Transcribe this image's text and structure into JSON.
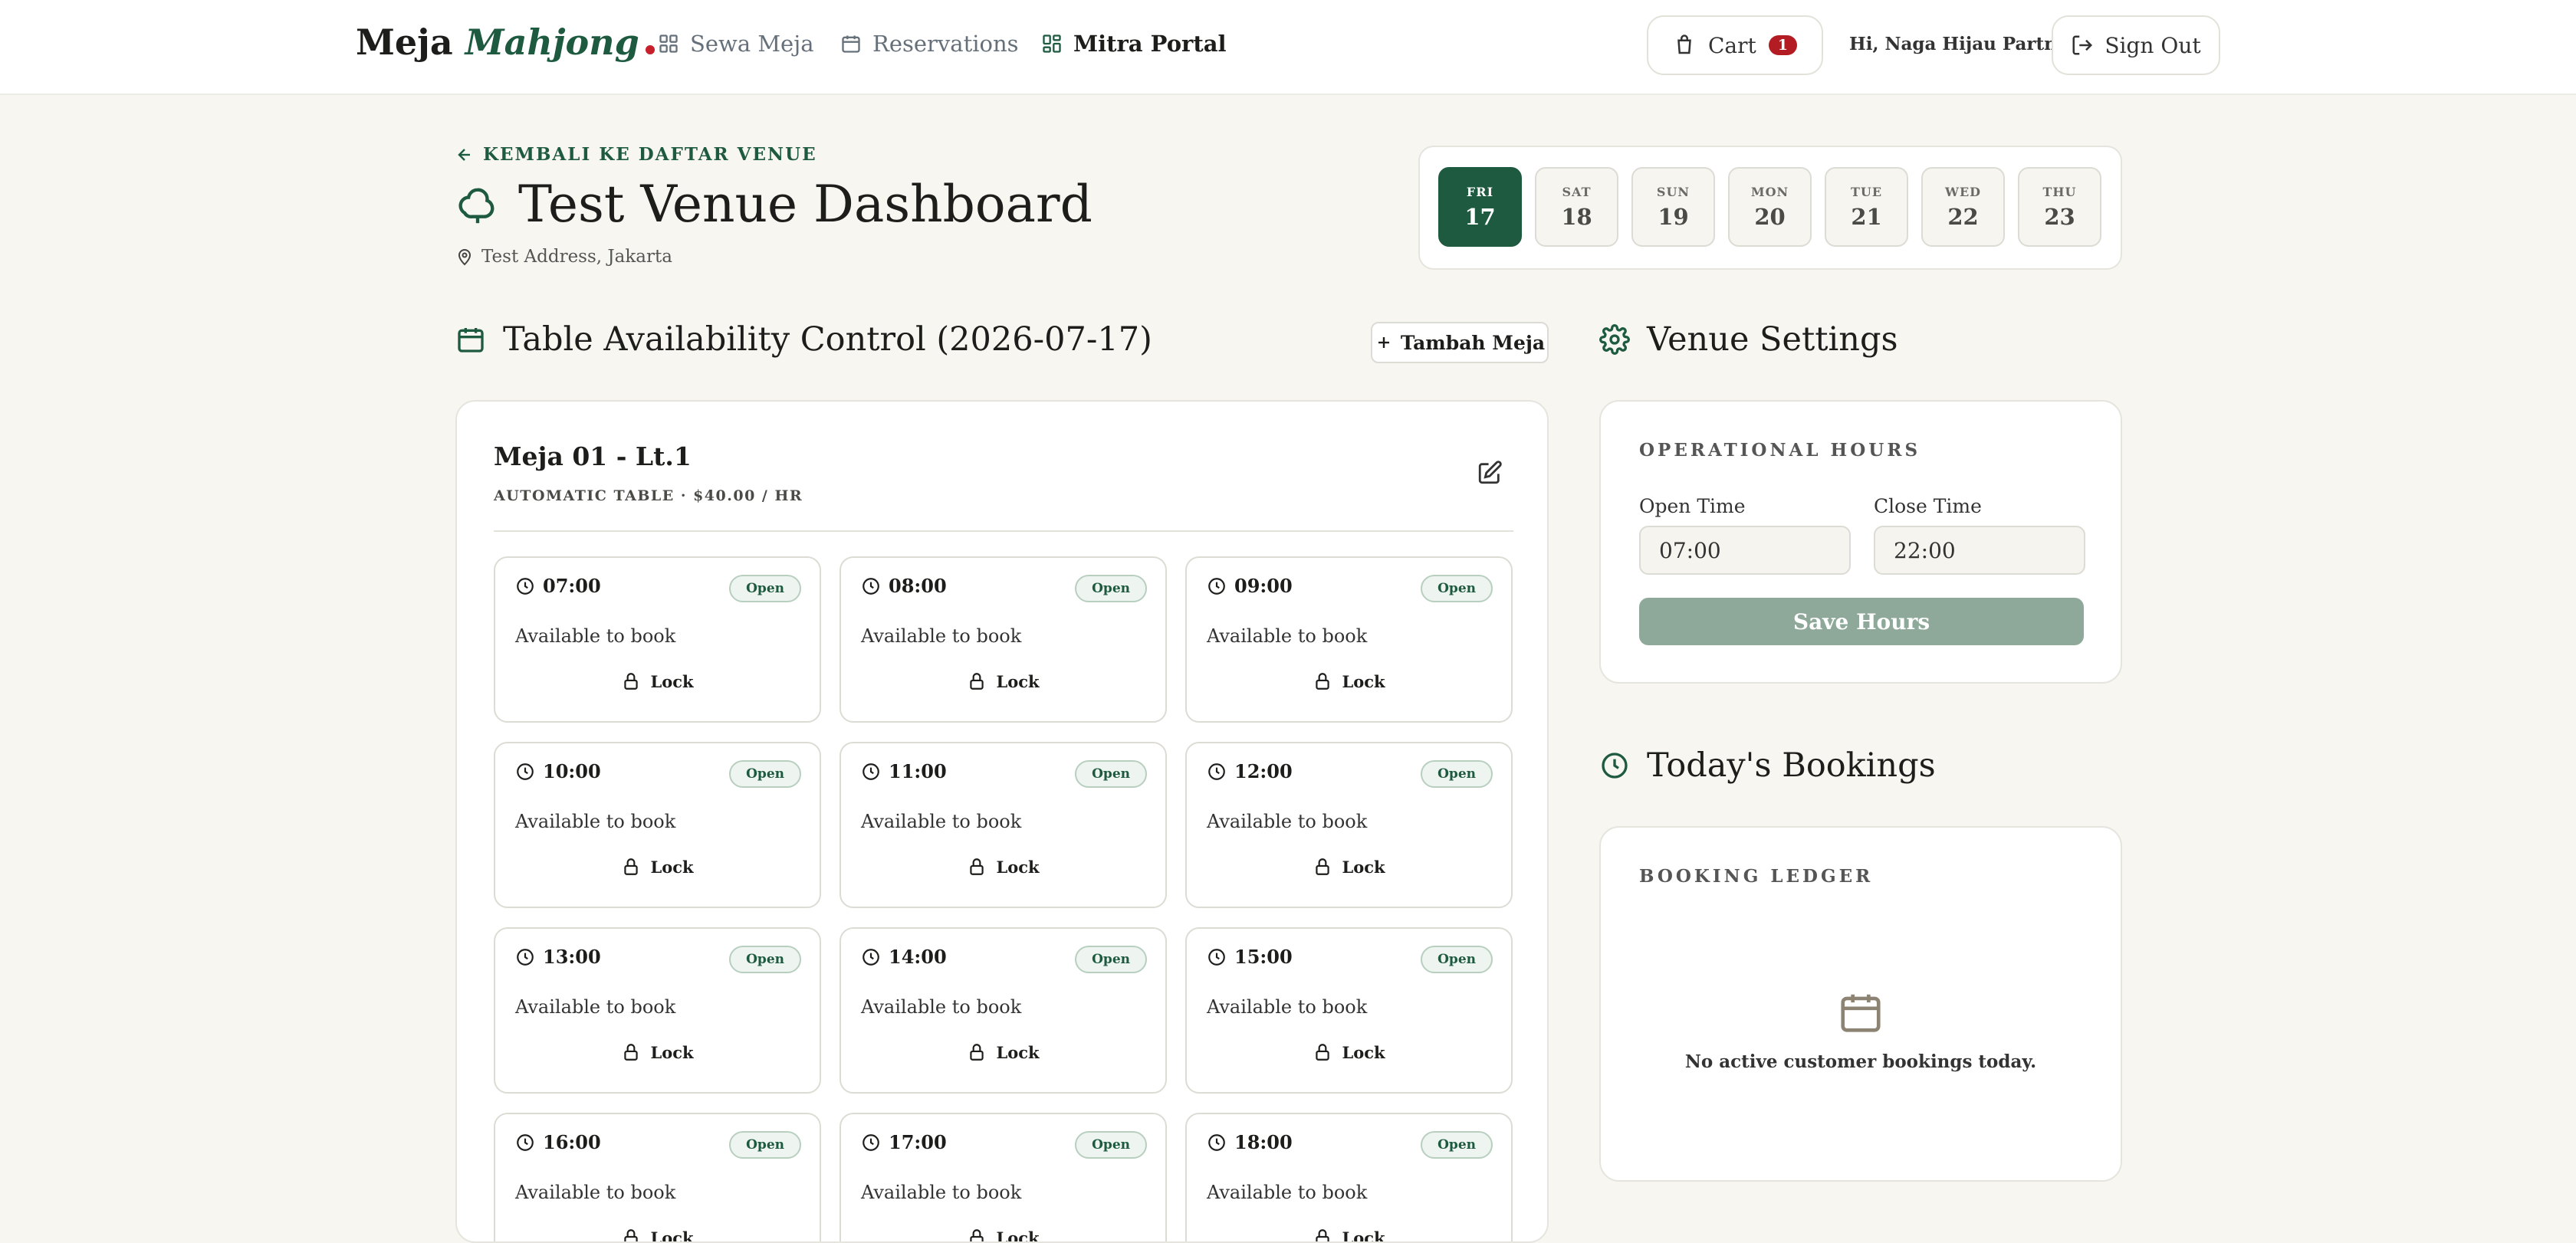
{
  "nav": {
    "logo_main": "Meja",
    "logo_accent": "Mahjong",
    "links": [
      {
        "label": "Sewa Meja"
      },
      {
        "label": "Reservations"
      },
      {
        "label": "Mitra Portal"
      }
    ],
    "cart_label": "Cart",
    "cart_count": "1",
    "greeting": "Hi, Naga Hijau Partner",
    "sign_out_label": "Sign Out"
  },
  "venue": {
    "back_label": "KEMBALI KE DAFTAR VENUE",
    "title": "Test Venue Dashboard",
    "address": "Test Address, Jakarta"
  },
  "dates": [
    {
      "day": "FRI",
      "num": "17",
      "selected": true
    },
    {
      "day": "SAT",
      "num": "18"
    },
    {
      "day": "SUN",
      "num": "19"
    },
    {
      "day": "MON",
      "num": "20"
    },
    {
      "day": "TUE",
      "num": "21"
    },
    {
      "day": "WED",
      "num": "22"
    },
    {
      "day": "THU",
      "num": "23"
    }
  ],
  "availability": {
    "heading": "Table Availability Control (2026-07-17)",
    "add_table_label": "Tambah Meja",
    "table": {
      "name": "Meja 01 - Lt.1",
      "subtitle": "AUTOMATIC TABLE · $40.00 / HR"
    },
    "slots": [
      {
        "time": "07:00",
        "status": "Open",
        "desc": "Available to book",
        "action": "Lock"
      },
      {
        "time": "08:00",
        "status": "Open",
        "desc": "Available to book",
        "action": "Lock"
      },
      {
        "time": "09:00",
        "status": "Open",
        "desc": "Available to book",
        "action": "Lock"
      },
      {
        "time": "10:00",
        "status": "Open",
        "desc": "Available to book",
        "action": "Lock"
      },
      {
        "time": "11:00",
        "status": "Open",
        "desc": "Available to book",
        "action": "Lock"
      },
      {
        "time": "12:00",
        "status": "Open",
        "desc": "Available to book",
        "action": "Lock"
      },
      {
        "time": "13:00",
        "status": "Open",
        "desc": "Available to book",
        "action": "Lock"
      },
      {
        "time": "14:00",
        "status": "Open",
        "desc": "Available to book",
        "action": "Lock"
      },
      {
        "time": "15:00",
        "status": "Open",
        "desc": "Available to book",
        "action": "Lock"
      },
      {
        "time": "16:00",
        "status": "Open",
        "desc": "Available to book",
        "action": "Lock"
      },
      {
        "time": "17:00",
        "status": "Open",
        "desc": "Available to book",
        "action": "Lock"
      },
      {
        "time": "18:00",
        "status": "Open",
        "desc": "Available to book",
        "action": "Lock"
      }
    ]
  },
  "settings": {
    "heading": "Venue Settings",
    "section_label": "OPERATIONAL HOURS",
    "open_label": "Open Time",
    "open_value": "07:00",
    "close_label": "Close Time",
    "close_value": "22:00",
    "save_label": "Save Hours"
  },
  "bookings": {
    "heading": "Today's Bookings",
    "section_label": "BOOKING LEDGER",
    "empty_text": "No active customer bookings today."
  },
  "colors": {
    "brand_green": "#1e5a40",
    "alert_red": "#b31c22",
    "background": "#f7f6f1",
    "save_disabled": "#8ea99a"
  },
  "icons": [
    "grid-icon",
    "calendar-icon",
    "dashboard-icon",
    "cart-icon",
    "sign-out-icon",
    "arrow-left-icon",
    "cloud-icon",
    "map-pin-icon",
    "plus-icon",
    "edit-icon",
    "clock-icon",
    "lock-icon",
    "gear-icon"
  ]
}
